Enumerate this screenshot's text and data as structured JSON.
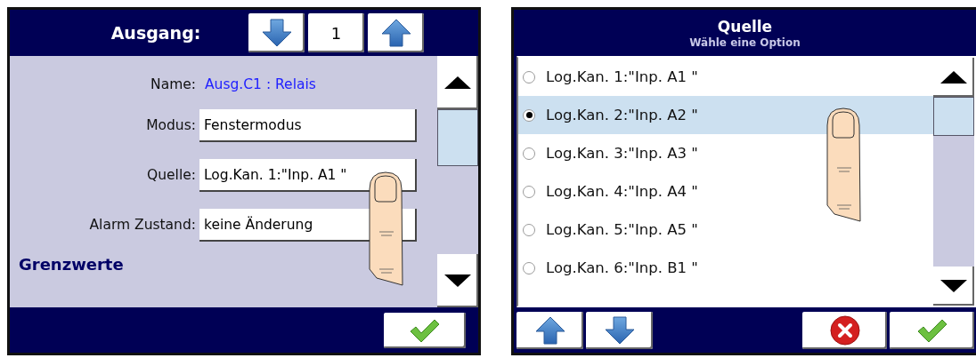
{
  "output_screen": {
    "title": "Ausgang:",
    "number": "1",
    "fields": [
      {
        "kind": "text",
        "label": "Name:",
        "value": "Ausg.C1 : Relais"
      },
      {
        "kind": "select",
        "label": "Modus:",
        "value": "Fenstermodus"
      },
      {
        "kind": "select",
        "label": "Quelle:",
        "value": "Log.Kan. 1:\"Inp. A1 \""
      },
      {
        "kind": "select",
        "label": "Alarm Zustand:",
        "value": "keine Änderung"
      }
    ],
    "section": "Grenzwerte"
  },
  "source_dialog": {
    "title": "Quelle",
    "subtitle": "Wähle eine Option",
    "options": [
      {
        "label": "Log.Kan. 1:\"Inp. A1 \"",
        "selected": false
      },
      {
        "label": "Log.Kan. 2:\"Inp. A2 \"",
        "selected": true
      },
      {
        "label": "Log.Kan. 3:\"Inp. A3 \"",
        "selected": false
      },
      {
        "label": "Log.Kan. 4:\"Inp. A4 \"",
        "selected": false
      },
      {
        "label": "Log.Kan. 5:\"Inp. A5 \"",
        "selected": false
      },
      {
        "label": "Log.Kan. 6:\"Inp. B1 \"",
        "selected": false
      }
    ]
  }
}
